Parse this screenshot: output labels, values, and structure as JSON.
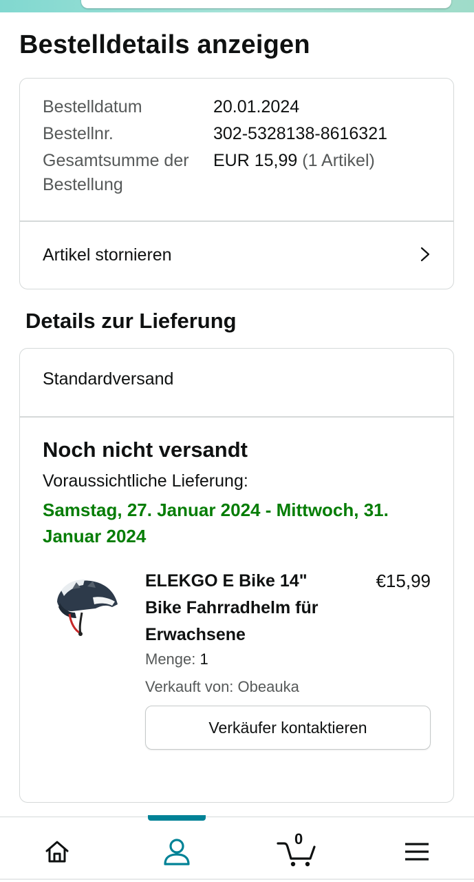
{
  "page": {
    "title": "Bestelldetails anzeigen"
  },
  "order_summary": {
    "rows": [
      {
        "label": "Bestelldatum",
        "value": "20.01.2024"
      },
      {
        "label": "Bestellnr.",
        "value": "302-5328138-8616321"
      },
      {
        "label": "Gesamtsumme der Bestellung",
        "value": "EUR 15,99",
        "value_note": "(1 Artikel)"
      }
    ],
    "cancel_label": "Artikel stornieren"
  },
  "delivery": {
    "section_title": "Details zur Lieferung",
    "shipping_type": "Standardversand",
    "status": "Noch nicht versandt",
    "eta_label": "Voraussichtliche Lieferung:",
    "eta_date": "Samstag, 27. Januar 2024 - Mittwoch, 31. Januar 2024",
    "eta_color": "#067d06"
  },
  "product": {
    "name": "ELEKGO E Bike 14\" Bike Fahrradhelm für Erwachsene",
    "price": "€15,99",
    "qty_label": "Menge:",
    "qty_value": "1",
    "seller": "Verkauft von: Obeauka",
    "contact_button": "Verkäufer kontaktieren",
    "image_icon": "bike-helmet-image"
  },
  "bottom_nav": {
    "items": [
      {
        "name": "home",
        "icon": "home-icon"
      },
      {
        "name": "account",
        "icon": "user-icon",
        "active": true
      },
      {
        "name": "cart",
        "icon": "cart-icon"
      },
      {
        "name": "menu",
        "icon": "hamburger-menu-icon"
      }
    ],
    "cart_count": "0",
    "accent": "#008296"
  }
}
